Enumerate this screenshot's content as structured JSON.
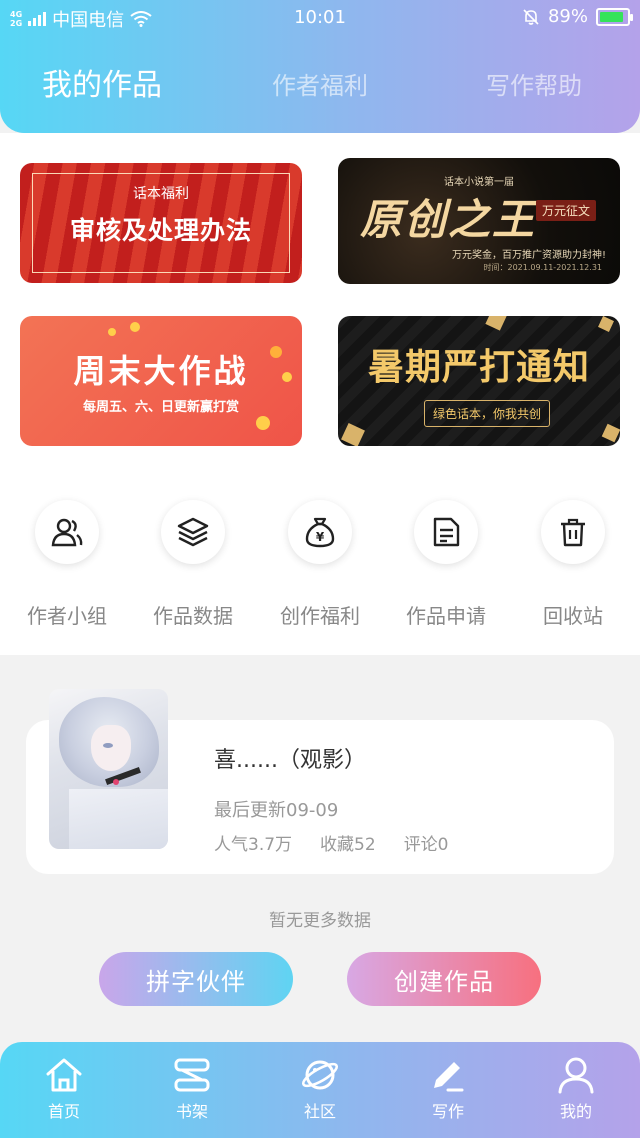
{
  "status_bar": {
    "network_top": "4G",
    "network_bottom": "2G",
    "carrier": "中国电信",
    "time": "10:01",
    "battery_percent": "89%",
    "battery_level": 0.89
  },
  "header": {
    "tabs": [
      {
        "label": "我的作品",
        "active": true
      },
      {
        "label": "作者福利",
        "active": false
      },
      {
        "label": "写作帮助",
        "active": false
      }
    ]
  },
  "banners": [
    {
      "small": "话本福利",
      "big": "审核及处理办法"
    },
    {
      "small": "话本小说第一届",
      "big": "原创之王",
      "tag": "万元征文",
      "line": "万元奖金，百万推广资源助力封神!",
      "time": "时间：2021.09.11-2021.12.31"
    },
    {
      "big": "周末大作战",
      "small": "每周五、六、日更新赢打赏"
    },
    {
      "big": "暑期严打通知",
      "pill": "绿色话本，你我共创"
    }
  ],
  "shortcuts": [
    {
      "label": "作者小组",
      "icon": "author-group-icon"
    },
    {
      "label": "作品数据",
      "icon": "layers-icon"
    },
    {
      "label": "创作福利",
      "icon": "money-bag-icon"
    },
    {
      "label": "作品申请",
      "icon": "document-icon"
    },
    {
      "label": "回收站",
      "icon": "trash-icon"
    }
  ],
  "work": {
    "title": "喜......（观影）",
    "last_update": "最后更新09-09",
    "popularity": "人气3.7万",
    "favorites": "收藏52",
    "comments": "评论0"
  },
  "no_more": "暂无更多数据",
  "buttons": {
    "partner": "拼字伙伴",
    "create": "创建作品"
  },
  "bottom_nav": [
    {
      "label": "首页",
      "icon": "home-icon"
    },
    {
      "label": "书架",
      "icon": "bookshelf-icon"
    },
    {
      "label": "社区",
      "icon": "planet-icon"
    },
    {
      "label": "写作",
      "icon": "pen-icon",
      "active": true
    },
    {
      "label": "我的",
      "icon": "profile-icon"
    }
  ],
  "colors": {
    "gradient_start": "#56d7f5",
    "gradient_end": "#b4a2ea",
    "create_button": "#f7707f"
  }
}
